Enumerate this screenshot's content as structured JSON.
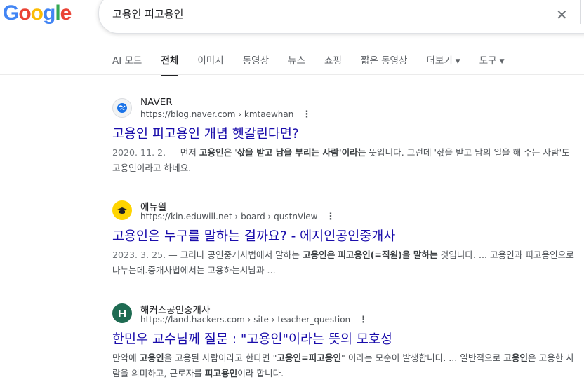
{
  "logo": {
    "letters": [
      "G",
      "o",
      "o",
      "g",
      "l",
      "e"
    ],
    "colors": [
      "#4285F4",
      "#EA4335",
      "#FBBC05",
      "#4285F4",
      "#34A853",
      "#EA4335"
    ]
  },
  "search": {
    "query": "고용인 피고용인"
  },
  "tabs": [
    {
      "label": "AI 모드"
    },
    {
      "label": "전체",
      "active": true
    },
    {
      "label": "이미지"
    },
    {
      "label": "동영상"
    },
    {
      "label": "뉴스"
    },
    {
      "label": "쇼핑"
    },
    {
      "label": "짧은 동영상"
    },
    {
      "label": "더보기",
      "caret": true
    },
    {
      "label": "도구",
      "caret": true
    }
  ],
  "results": [
    {
      "source": "NAVER",
      "url": "https://blog.naver.com › kmtaewhan",
      "title": "고용인 피고용인 개념 헷갈린다면?",
      "icon": "globe-icon",
      "date": "2020. 11. 2.",
      "snippet_segments": [
        {
          "t": " — 먼저 "
        },
        {
          "t": "고용인은",
          "b": true
        },
        {
          "t": " '"
        },
        {
          "t": "삯을 받고 남을 부리는 사람",
          "b": true
        },
        {
          "t": "'이라는",
          "b": true
        },
        {
          "t": " 뜻입니다. 그런데 '삯을 받고 남의 일을 해 주는 사람'도 고용인이라고 하네요."
        }
      ]
    },
    {
      "source": "에듀윌",
      "url": "https://kin.eduwill.net › board › qustnView",
      "title": "고용인은 누구를 말하는 걸까요? - 에지인공인중개사",
      "icon": "graduation-cap-icon",
      "date": "2023. 3. 25.",
      "snippet_segments": [
        {
          "t": " — 그러나 공인중개사법에서 말하는 "
        },
        {
          "t": "고용인은",
          "b": true
        },
        {
          "t": " "
        },
        {
          "t": "피고용인(=직원)을 말하는",
          "b": true
        },
        {
          "t": " 것입니다. ... 고용인과 피고용인으로 나누는데.중개사법에서는 고용하는시남과 ..."
        }
      ]
    },
    {
      "source": "해커스공인중개사",
      "url": "https://land.hackers.com › site › teacher_question",
      "title": "한민우 교수님께 질문 : \"고용인\"이라는 뜻의 모호성",
      "icon": "hackers-logo-icon",
      "date": "",
      "snippet_segments": [
        {
          "t": "만약에 "
        },
        {
          "t": "고용인",
          "b": true
        },
        {
          "t": "을 고용된 사람이라고 한다면 \""
        },
        {
          "t": "고용인=피고용인",
          "b": true
        },
        {
          "t": "\" 이라는 모순이 발생합니다. ... 일반적으로 "
        },
        {
          "t": "고용인",
          "b": true
        },
        {
          "t": "은 고용한 사람을 의미하고, 근로자를 "
        },
        {
          "t": "피고용인",
          "b": true
        },
        {
          "t": "이라 합니다."
        }
      ]
    }
  ]
}
